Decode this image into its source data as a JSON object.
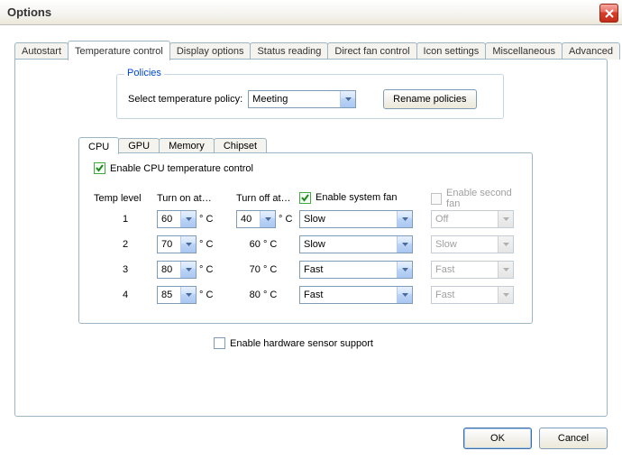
{
  "window": {
    "title": "Options"
  },
  "tabs": [
    {
      "label": "Autostart"
    },
    {
      "label": "Temperature control",
      "active": true
    },
    {
      "label": "Display options"
    },
    {
      "label": "Status reading"
    },
    {
      "label": "Direct fan control"
    },
    {
      "label": "Icon settings"
    },
    {
      "label": "Miscellaneous"
    },
    {
      "label": "Advanced"
    }
  ],
  "policies": {
    "group_title": "Policies",
    "label": "Select temperature policy:",
    "selected": "Meeting",
    "rename_btn": "Rename policies"
  },
  "components": {
    "tabs": [
      {
        "label": "CPU",
        "active": true
      },
      {
        "label": "GPU"
      },
      {
        "label": "Memory"
      },
      {
        "label": "Chipset"
      }
    ]
  },
  "cpu": {
    "enable_label": "Enable CPU temperature control",
    "enable_checked": true,
    "headers": {
      "level": "Temp level",
      "on": "Turn on at…",
      "off": "Turn off at…"
    },
    "system_fan": {
      "label": "Enable system fan",
      "checked": true
    },
    "second_fan": {
      "label": "Enable second fan",
      "checked": false,
      "enabled": false
    },
    "unit": "° C",
    "rows": [
      {
        "level": "1",
        "on": "60",
        "off": "40",
        "off_editable": true,
        "fan1": "Slow",
        "fan2": "Off"
      },
      {
        "level": "2",
        "on": "70",
        "off": "60",
        "off_editable": false,
        "fan1": "Slow",
        "fan2": "Slow"
      },
      {
        "level": "3",
        "on": "80",
        "off": "70",
        "off_editable": false,
        "fan1": "Fast",
        "fan2": "Fast"
      },
      {
        "level": "4",
        "on": "85",
        "off": "80",
        "off_editable": false,
        "fan1": "Fast",
        "fan2": "Fast"
      }
    ]
  },
  "hw_sensor": {
    "label": "Enable hardware sensor support",
    "checked": false
  },
  "footer": {
    "ok": "OK",
    "cancel": "Cancel"
  }
}
